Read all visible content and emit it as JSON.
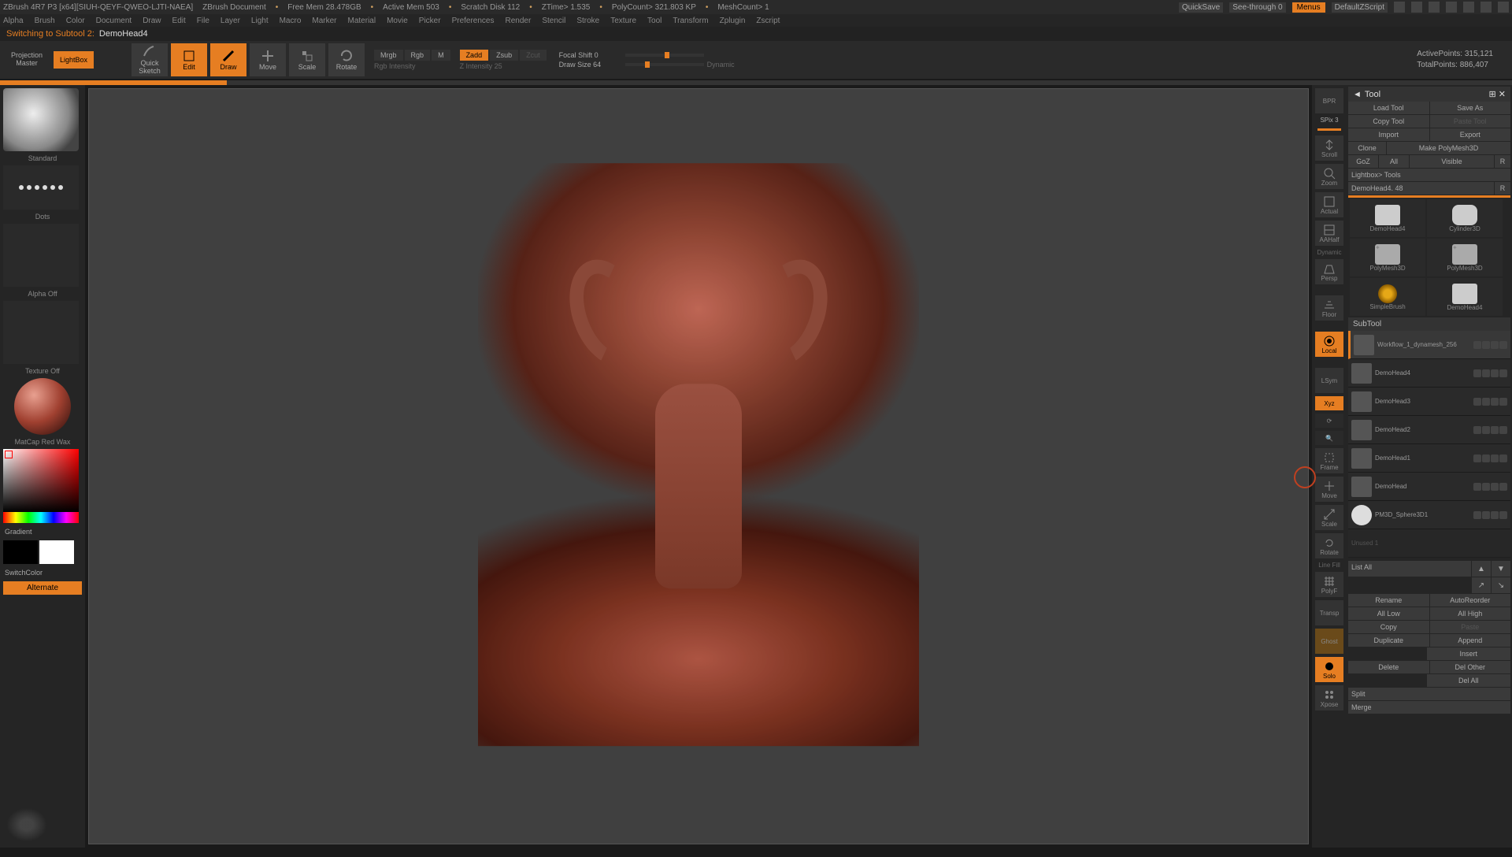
{
  "topbar": {
    "title": "ZBrush 4R7 P3 [x64][SIUH-QEYF-QWEO-LJTI-NAEA]",
    "doc": "ZBrush Document",
    "mem": "Free Mem 28.478GB",
    "activemem": "Active Mem 503",
    "scratch": "Scratch Disk 112",
    "ztime": "ZTime> 1.535",
    "polycount": "PolyCount> 321.803 KP",
    "meshcount": "MeshCount> 1",
    "quicksave": "QuickSave",
    "seethrough": "See-through  0",
    "menus": "Menus",
    "script": "DefaultZScript"
  },
  "menu": [
    "Alpha",
    "Brush",
    "Color",
    "Document",
    "Draw",
    "Edit",
    "File",
    "Layer",
    "Light",
    "Macro",
    "Marker",
    "Material",
    "Movie",
    "Picker",
    "Preferences",
    "Render",
    "Stencil",
    "Stroke",
    "Texture",
    "Tool",
    "Transform",
    "Zplugin",
    "Zscript"
  ],
  "status": {
    "prefix": "Switching to Subtool 2:",
    "name": "DemoHead4"
  },
  "toolbar": {
    "projection": "Projection Master",
    "lightbox": "LightBox",
    "quicksketch": "Quick Sketch",
    "edit": "Edit",
    "draw": "Draw",
    "move": "Move",
    "scale": "Scale",
    "rotate": "Rotate",
    "mrgb": "Mrgb",
    "rgb": "Rgb",
    "m": "M",
    "zadd": "Zadd",
    "zsub": "Zsub",
    "zcut": "Zcut",
    "rgbintensity": "Rgb Intensity",
    "zintensity": "Z Intensity 25",
    "focalshift": "Focal Shift 0",
    "drawsize": "Draw Size 64",
    "dynamic": "Dynamic",
    "activepoints": "ActivePoints: 315,121",
    "totalpoints": "TotalPoints: 886,407"
  },
  "left": {
    "brush": "Standard",
    "stroke": "Dots",
    "alpha": "Alpha Off",
    "texture": "Texture Off",
    "material": "MatCap Red Wax",
    "gradient": "Gradient",
    "switchcolor": "SwitchColor",
    "alternate": "Alternate"
  },
  "rightstrip": {
    "spix": "SPix 3",
    "bpr": "BPR",
    "scroll": "Scroll",
    "zoom": "Zoom",
    "actual": "Actual",
    "aahalf": "AAHalf",
    "persp": "Persp",
    "floor": "Floor",
    "local": "Local",
    "xyz": "Xyz",
    "frame": "Frame",
    "move": "Move",
    "scale": "Scale",
    "rotate": "Rotate",
    "linefill": "Line Fill",
    "polyf": "PolyF",
    "transp": "Transp",
    "ghost": "Ghost",
    "solo": "Solo",
    "xpose": "Xpose",
    "lsym": "LSym",
    "dynamic": "Dynamic"
  },
  "tool": {
    "title": "Tool",
    "loadtool": "Load Tool",
    "saveas": "Save As",
    "copytool": "Copy Tool",
    "pastetool": "Paste Tool",
    "import": "Import",
    "export": "Export",
    "clone": "Clone",
    "makepoly": "Make PolyMesh3D",
    "goz": "GoZ",
    "all": "All",
    "visible": "Visible",
    "r": "R",
    "lightboxtools": "Lightbox> Tools",
    "currenttool": "DemoHead4. 48",
    "tiles": [
      "DemoHead4",
      "Cylinder3D",
      "",
      "PolyMesh3D",
      "SimpleBrush",
      "DemoHead4"
    ],
    "subtool": "SubTool",
    "subitems": [
      {
        "name": "Workflow_1_dynamesh_256",
        "sel": true
      },
      {
        "name": "DemoHead4"
      },
      {
        "name": "DemoHead3"
      },
      {
        "name": "DemoHead2"
      },
      {
        "name": "DemoHead1"
      },
      {
        "name": "DemoHead"
      },
      {
        "name": "PM3D_Sphere3D1"
      }
    ],
    "unused": "Unused 1",
    "listall": "List All",
    "rename": "Rename",
    "autoreorder": "AutoReorder",
    "alllow": "All Low",
    "allhigh": "All High",
    "copy": "Copy",
    "paste": "Paste",
    "duplicate": "Duplicate",
    "append": "Append",
    "insert": "Insert",
    "delete": "Delete",
    "delother": "Del Other",
    "delall": "Del All",
    "split": "Split",
    "merge": "Merge"
  }
}
